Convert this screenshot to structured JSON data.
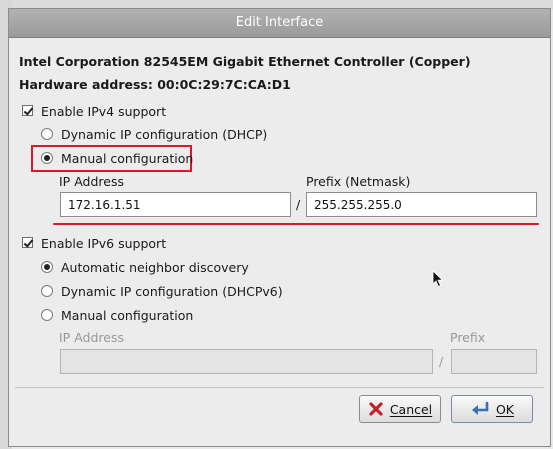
{
  "dialog": {
    "title": "Edit Interface",
    "device_name": "Intel Corporation 82545EM Gigabit Ethernet Controller (Copper)",
    "hardware_address": "Hardware address: 00:0C:29:7C:CA:D1"
  },
  "ipv4": {
    "enable_label": "Enable IPv4 support",
    "enabled": true,
    "dhcp_label": "Dynamic IP configuration (DHCP)",
    "manual_label": "Manual configuration",
    "selected": "manual",
    "ip_address_label": "IP Address",
    "prefix_label": "Prefix (Netmask)",
    "ip_address_value": "172.16.1.51",
    "separator": "/",
    "prefix_value": "255.255.255.0"
  },
  "ipv6": {
    "enable_label": "Enable IPv6 support",
    "enabled": true,
    "auto_label": "Automatic neighbor discovery",
    "dhcp_label": "Dynamic IP configuration (DHCPv6)",
    "manual_label": "Manual configuration",
    "selected": "auto",
    "ip_address_label": "IP Address",
    "prefix_label": "Prefix",
    "ip_address_value": "",
    "separator": "/",
    "prefix_value": ""
  },
  "buttons": {
    "cancel_label": "Cancel",
    "ok_label": "OK"
  },
  "colors": {
    "highlight": "#d51a2b",
    "titlebar": "#a6a6a6",
    "cancel_icon": "#c8202a",
    "ok_icon": "#3a6fb3"
  }
}
